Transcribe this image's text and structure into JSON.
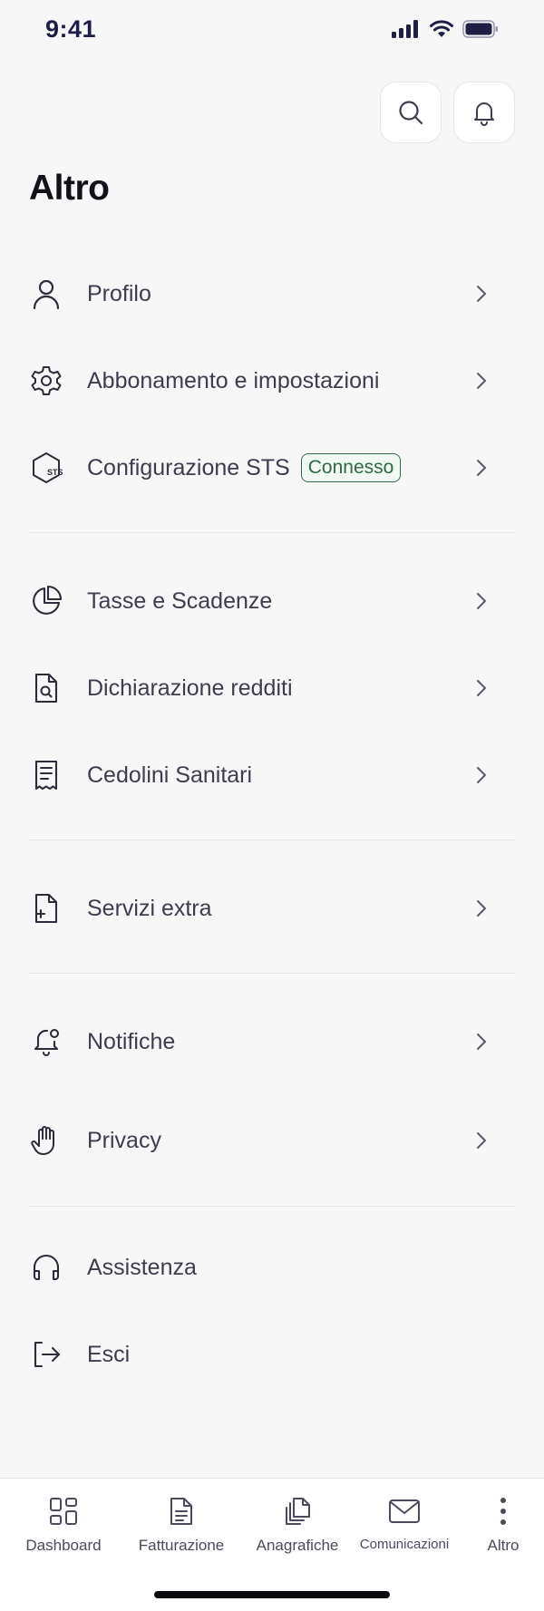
{
  "status_bar": {
    "time": "9:41"
  },
  "page": {
    "title": "Altro"
  },
  "menu": {
    "profilo": "Profilo",
    "abbonamento": "Abbonamento e impostazioni",
    "sts": "Configurazione STS",
    "sts_badge": "Connesso",
    "sts_icon_text": "STS",
    "tasse": "Tasse e Scadenze",
    "dichiarazione": "Dichiarazione redditi",
    "cedolini": "Cedolini Sanitari",
    "servizi": "Servizi extra",
    "notifiche": "Notifiche",
    "privacy": "Privacy",
    "assistenza": "Assistenza",
    "esci": "Esci"
  },
  "bottom_nav": {
    "dashboard": "Dashboard",
    "fatturazione": "Fatturazione",
    "anagrafiche": "Anagrafiche",
    "comunicazioni": "Comunicazioni",
    "altro": "Altro"
  },
  "colors": {
    "background": "#f7f7f8",
    "text": "#3d3d4e",
    "badge": "#2f6b45",
    "status": "#1e1e46"
  }
}
